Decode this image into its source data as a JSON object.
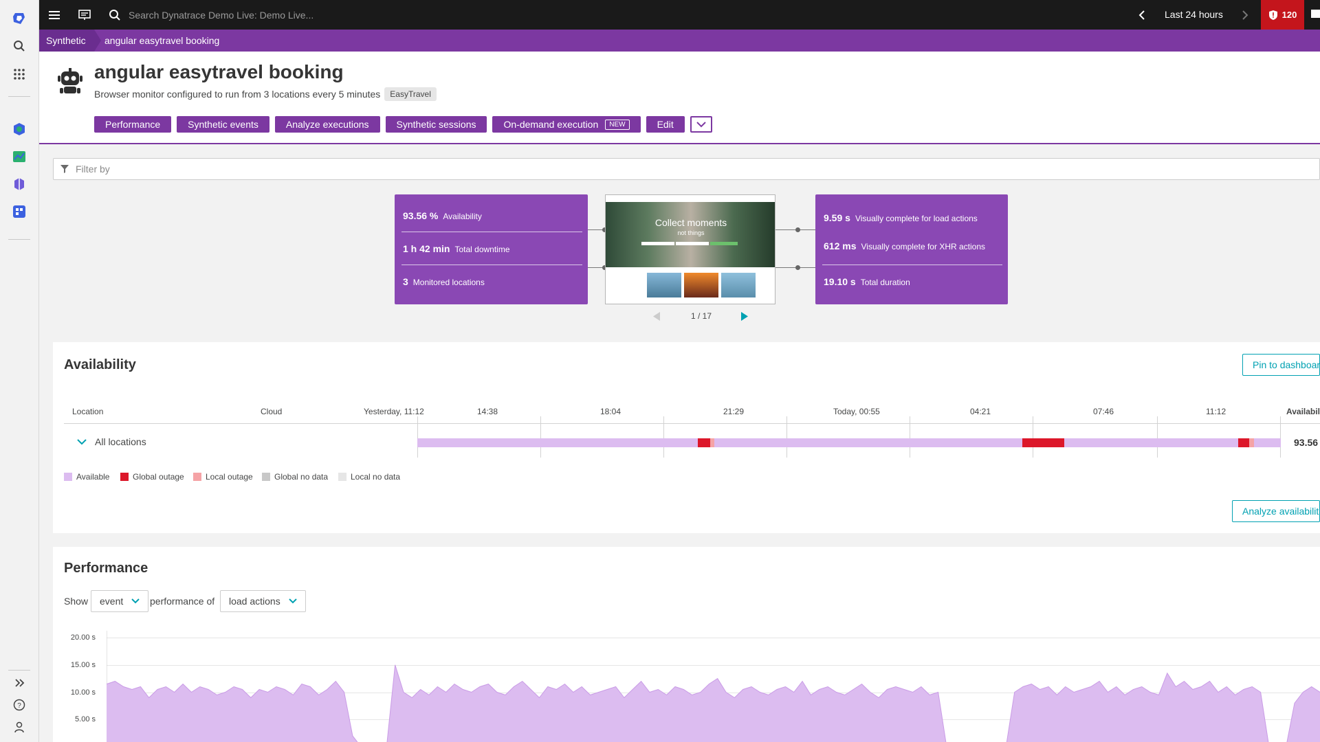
{
  "search": {
    "placeholder": "Search Dynatrace Demo Live: Demo Live..."
  },
  "topbar": {
    "timeframe": "Last 24 hours",
    "problems_count": "120"
  },
  "breadcrumb": {
    "root": "Synthetic",
    "current": "angular easytravel booking"
  },
  "header": {
    "title": "angular easytravel booking",
    "subtitle": "Browser monitor configured to run from 3 locations every 5 minutes",
    "tag": "EasyTravel",
    "buttons": {
      "performance": "Performance",
      "synthetic_events": "Synthetic events",
      "analyze_executions": "Analyze executions",
      "synthetic_sessions": "Synthetic sessions",
      "on_demand": "On-demand execution",
      "new_badge": "NEW",
      "edit": "Edit"
    }
  },
  "filter": {
    "placeholder": "Filter by"
  },
  "summary": {
    "left": [
      {
        "value": "93.56 %",
        "label": "Availability"
      },
      {
        "value": "1 h 42 min",
        "label": "Total downtime"
      },
      {
        "value": "3",
        "label": "Monitored locations"
      }
    ],
    "right": [
      {
        "value": "9.59 s",
        "label": "Visually complete for load actions"
      },
      {
        "value": "612 ms",
        "label": "Visually complete for XHR actions"
      },
      {
        "value": "19.10 s",
        "label": "Total duration"
      }
    ],
    "screenshot_headline": "Collect moments",
    "screenshot_subline": "not things",
    "pager": "1 / 17"
  },
  "availability": {
    "title": "Availability",
    "pin_button": "Pin to dashboar",
    "analyze_button": "Analyze availabilit",
    "columns": {
      "location": "Location",
      "cloud": "Cloud",
      "availability": "Availabili"
    },
    "time_ticks": [
      "Yesterday, 11:12",
      "14:38",
      "18:04",
      "21:29",
      "Today, 00:55",
      "04:21",
      "07:46",
      "11:12"
    ],
    "row": {
      "location": "All locations",
      "value": "93.56"
    },
    "outages": [
      {
        "type": "global",
        "start": 0.325,
        "end": 0.339
      },
      {
        "type": "local",
        "start": 0.339,
        "end": 0.344
      },
      {
        "type": "global",
        "start": 0.701,
        "end": 0.749
      },
      {
        "type": "global",
        "start": 0.951,
        "end": 0.963
      },
      {
        "type": "local",
        "start": 0.963,
        "end": 0.969
      }
    ],
    "legend": [
      "Available",
      "Global outage",
      "Local outage",
      "Global no data",
      "Local no data"
    ],
    "colors": {
      "available": "#dcbcf0",
      "global_outage": "#dc172a",
      "local_outage": "#f5a3a6",
      "global_no_data": "#c8c8c8",
      "local_no_data": "#e6e6e6"
    }
  },
  "performance": {
    "title": "Performance",
    "show_label": "Show",
    "show_value": "event",
    "of_label": "performance of",
    "of_value": "load actions",
    "y_ticks": [
      "20.00 s",
      "15.00 s",
      "10.00 s",
      "5.00 s"
    ]
  },
  "chart_data": {
    "type": "area",
    "ylabel": "",
    "ylim": [
      0,
      20
    ],
    "y_ticks": [
      5,
      10,
      15,
      20
    ],
    "series": [
      {
        "values": [
          11.5,
          12,
          11,
          10.5,
          11,
          9,
          10.5,
          11,
          10,
          11.5,
          10,
          11,
          10.5,
          9.5,
          10,
          11,
          10.5,
          9,
          10.5,
          10,
          11,
          10.5,
          9.5,
          11.5,
          11,
          9.5,
          10.5,
          12,
          10,
          2,
          0,
          0,
          0,
          0,
          15,
          10,
          9,
          10.5,
          9.5,
          11,
          10,
          11.5,
          10.5,
          10,
          11,
          11.5,
          10,
          9.5,
          11,
          12,
          10.5,
          9,
          11,
          10.5,
          11.5,
          10,
          11,
          9.5,
          10,
          10.5,
          11,
          9,
          10.5,
          12,
          10,
          10.5,
          9.5,
          11,
          10.5,
          9.5,
          10,
          11.5,
          12.5,
          10,
          9,
          10.5,
          11,
          10,
          9.5,
          10.5,
          11,
          10,
          12,
          9.5,
          10.5,
          11,
          10,
          9.5,
          10.5,
          11.5,
          10,
          9,
          10.5,
          11,
          10.5,
          10,
          11,
          9.5,
          10,
          0,
          0,
          0,
          0,
          0,
          0,
          0,
          0,
          10,
          11,
          11.5,
          10.5,
          11,
          9.5,
          11,
          10,
          10.5,
          11,
          12,
          10,
          11,
          9.5,
          10.5,
          11,
          10,
          9.5,
          13.5,
          11,
          12,
          10.5,
          11,
          12,
          10,
          11,
          9.5,
          10.5,
          11,
          10,
          0,
          0,
          0,
          8,
          10,
          11,
          10
        ]
      }
    ]
  }
}
